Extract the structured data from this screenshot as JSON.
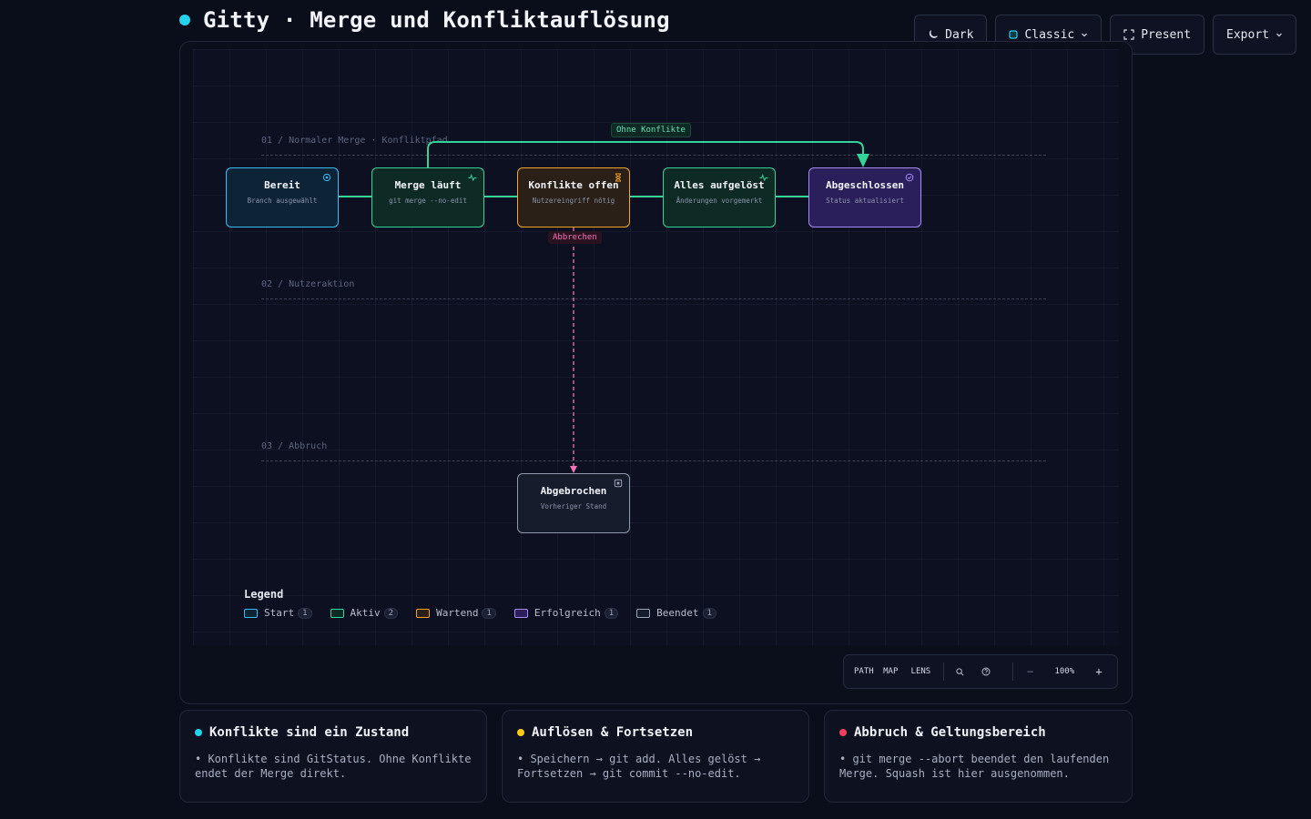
{
  "header": {
    "title": "Gitty · Merge und Konfliktauflösung"
  },
  "toolbar": {
    "theme_label": "Dark",
    "style_label": "Classic",
    "present_label": "Present",
    "export_label": "Export"
  },
  "lanes": [
    {
      "label": "01 / Normaler Merge · Konfliktpfad"
    },
    {
      "label": "02 / Nutzeraktion"
    },
    {
      "label": "03 / Abbruch"
    }
  ],
  "nodes": {
    "bereit": {
      "title": "Bereit",
      "subtitle": "Branch ausgewählt",
      "status": "Start",
      "icon": "target-icon"
    },
    "merge": {
      "title": "Merge läuft",
      "subtitle": "git merge --no-edit",
      "status": "Aktiv",
      "icon": "pulse-icon"
    },
    "konflikte": {
      "title": "Konflikte offen",
      "subtitle": "Nutzereingriff nötig",
      "status": "Wartend",
      "icon": "hourglass-icon"
    },
    "aufgeloest": {
      "title": "Alles aufgelöst",
      "subtitle": "Änderungen vorgemerkt",
      "status": "Aktiv",
      "icon": "pulse-icon"
    },
    "abgeschlossen": {
      "title": "Abgeschlossen",
      "subtitle": "Status aktualisiert",
      "status": "Erfolgreich",
      "icon": "check-circle-icon"
    },
    "abgebrochen": {
      "title": "Abgebrochen",
      "subtitle": "Vorheriger Stand",
      "status": "Beendet",
      "icon": "stop-square-icon"
    }
  },
  "edges": [
    {
      "from": "bereit",
      "to": "merge",
      "label": ""
    },
    {
      "from": "merge",
      "to": "konflikte",
      "label": ""
    },
    {
      "from": "konflikte",
      "to": "aufgeloest",
      "label": ""
    },
    {
      "from": "aufgeloest",
      "to": "abgeschlossen",
      "label": ""
    },
    {
      "from": "merge",
      "to": "abgeschlossen",
      "label": "Ohne Konflikte"
    },
    {
      "from": "konflikte",
      "to": "abgebrochen",
      "label": "Abbrechen"
    }
  ],
  "legend": {
    "title": "Legend",
    "items": [
      {
        "label": "Start",
        "count": "1",
        "color": "#38bdf8"
      },
      {
        "label": "Aktiv",
        "count": "2",
        "color": "#34d399"
      },
      {
        "label": "Wartend",
        "count": "1",
        "color": "#f5a524"
      },
      {
        "label": "Erfolgreich",
        "count": "1",
        "color": "#a78bfa"
      },
      {
        "label": "Beendet",
        "count": "1",
        "color": "#9aa3b8"
      }
    ]
  },
  "controls": {
    "path": "PATH",
    "map": "MAP",
    "lens": "LENS",
    "zoom": "100%"
  },
  "cards": [
    {
      "title": "Konflikte sind ein Zustand",
      "dot_color": "#22d3ee",
      "text": "• Konflikte sind GitStatus. Ohne Konflikte endet der Merge direkt."
    },
    {
      "title": "Auflösen & Fortsetzen",
      "dot_color": "#facc15",
      "text": "• Speichern → git add. Alles gelöst → Fortsetzen → git commit --no-edit."
    },
    {
      "title": "Abbruch & Geltungsbereich",
      "dot_color": "#f43f5e",
      "text": "• git merge --abort beendet den laufenden Merge. Squash ist hier ausgenommen."
    }
  ]
}
